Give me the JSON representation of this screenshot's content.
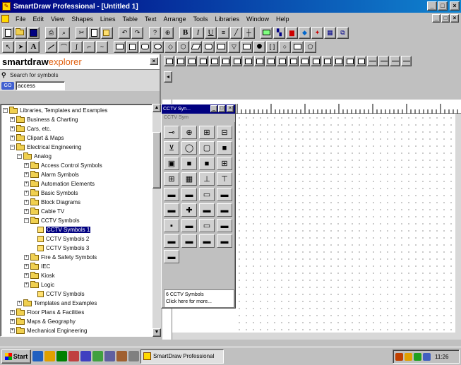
{
  "window": {
    "title": "SmartDraw Professional - [Untitled 1]",
    "controls": [
      "_",
      "□",
      "×"
    ]
  },
  "menu": {
    "items": [
      "File",
      "Edit",
      "View",
      "Shapes",
      "Lines",
      "Table",
      "Text",
      "Arrange",
      "Tools",
      "Libraries",
      "Window",
      "Help"
    ],
    "mdi_controls": [
      "_",
      "□",
      "×"
    ]
  },
  "toolbar1": {
    "buttons": [
      "new-icon",
      "open-icon",
      "save-icon",
      "print-icon",
      "cut-icon",
      "copy-icon",
      "paste-icon",
      "undo-icon",
      "redo-icon",
      "help-icon",
      "bold-icon",
      "italic-icon",
      "underline-icon",
      "fill-icon",
      "line-color-icon",
      "chart-icon",
      "table-icon",
      "link-icon"
    ],
    "bold_label": "B",
    "italic_label": "I",
    "underline_label": "U"
  },
  "toolbar2": {
    "pointer_label": "",
    "text_tool_label": "A"
  },
  "explorer": {
    "brand_main": "smartdraw",
    "brand_accent": "explorer",
    "close_label": "×",
    "search_label": "Search for symbols",
    "go_label": "GO",
    "search_value": "access",
    "tree": [
      {
        "label": "Libraries, Templates and Examples",
        "level": 0,
        "expander": "−",
        "selected": false
      },
      {
        "label": "Business & Charting",
        "level": 1,
        "expander": "+",
        "selected": false
      },
      {
        "label": "Cars, etc.",
        "level": 1,
        "expander": "+",
        "selected": false
      },
      {
        "label": "Clipart & Maps",
        "level": 1,
        "expander": "+",
        "selected": false
      },
      {
        "label": "Electrical Engineering",
        "level": 1,
        "expander": "−",
        "selected": false
      },
      {
        "label": "Analog",
        "level": 2,
        "expander": "−",
        "selected": false
      },
      {
        "label": "Access Control Symbols",
        "level": 3,
        "expander": "+",
        "selected": false
      },
      {
        "label": "Alarm Symbols",
        "level": 3,
        "expander": "+",
        "selected": false
      },
      {
        "label": "Automation Elements",
        "level": 3,
        "expander": "+",
        "selected": false
      },
      {
        "label": "Basic Symbols",
        "level": 3,
        "expander": "+",
        "selected": false
      },
      {
        "label": "Block Diagrams",
        "level": 3,
        "expander": "+",
        "selected": false
      },
      {
        "label": "Cable TV",
        "level": 3,
        "expander": "+",
        "selected": false
      },
      {
        "label": "CCTV Symbols",
        "level": 3,
        "expander": "−",
        "selected": false
      },
      {
        "label": "CCTV Symbols 1",
        "level": 4,
        "expander": "",
        "selected": true
      },
      {
        "label": "CCTV Symbols 2",
        "level": 4,
        "expander": "",
        "selected": false
      },
      {
        "label": "CCTV Symbols 3",
        "level": 4,
        "expander": "",
        "selected": false
      },
      {
        "label": "Fire & Safety Symbols",
        "level": 3,
        "expander": "+",
        "selected": false
      },
      {
        "label": "IEC",
        "level": 3,
        "expander": "+",
        "selected": false
      },
      {
        "label": "Kiosk",
        "level": 3,
        "expander": "+",
        "selected": false
      },
      {
        "label": "Logic",
        "level": 3,
        "expander": "+",
        "selected": false
      },
      {
        "label": "CCTV Symbols",
        "level": 4,
        "expander": "",
        "selected": false
      },
      {
        "label": "Templates and Examples",
        "level": 2,
        "expander": "+",
        "selected": false
      },
      {
        "label": "Floor Plans & Facilities",
        "level": 1,
        "expander": "+",
        "selected": false
      },
      {
        "label": "Maps & Geography",
        "level": 1,
        "expander": "+",
        "selected": false
      },
      {
        "label": "Mechanical Engineering",
        "level": 1,
        "expander": "+",
        "selected": false
      }
    ]
  },
  "palette": {
    "title": "CCTV Syn...",
    "subtitle": "CCTV Sym",
    "controls": [
      "_",
      "□",
      "×"
    ],
    "status_line1": "6 CCTV Symbols",
    "status_line2": "Click here for more..."
  },
  "taskbar": {
    "start_label": "Start",
    "task_label": "SmartDraw Professional",
    "clock": "11:26"
  },
  "colors": {
    "title_start": "#000080",
    "title_end": "#1084d0",
    "face": "#c0c0c0",
    "brand_accent": "#e06010",
    "selection": "#000080"
  }
}
